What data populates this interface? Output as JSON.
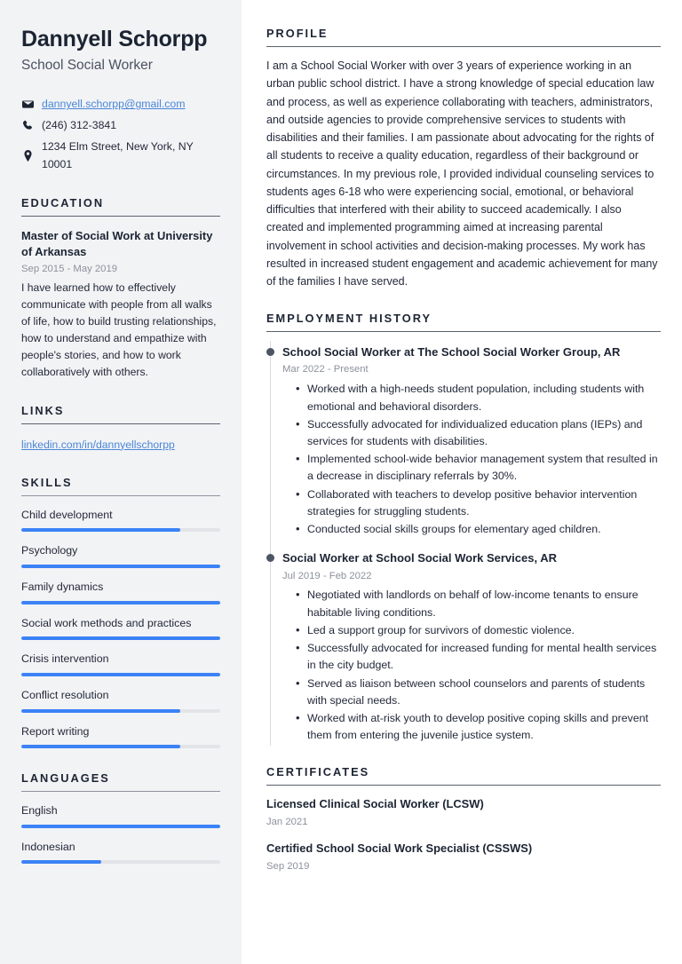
{
  "theme": {
    "sidebar_bg": "#f2f3f5",
    "main_bg": "#ffffff",
    "text_color": "#23293a",
    "heading_color": "#1c2433",
    "muted_color": "#8c919c",
    "link_color": "#4a86d8",
    "accent_bar": "#3b82f6",
    "bar_track": "#e2e4e7",
    "timeline_dot": "#4d5565"
  },
  "sidebar": {
    "name": "Dannyell Schorpp",
    "job_title": "School Social Worker",
    "contacts": [
      {
        "icon": "envelope-icon",
        "text": "dannyell.schorpp@gmail.com",
        "is_link": true
      },
      {
        "icon": "phone-icon",
        "text": "(246) 312-3841",
        "is_link": false
      },
      {
        "icon": "location-pin-icon",
        "text": "1234 Elm Street, New York, NY 10001",
        "is_link": false
      }
    ],
    "education": {
      "heading": "EDUCATION",
      "items": [
        {
          "title": "Master of Social Work at University of Arkansas",
          "date": "Sep 2015 - May 2019",
          "description": "I have learned how to effectively communicate with people from all walks of life, how to build trusting relationships, how to understand and empathize with people's stories, and how to work collaboratively with others."
        }
      ]
    },
    "links": {
      "heading": "LINKS",
      "items": [
        {
          "label": "linkedin.com/in/dannyellschorpp"
        }
      ]
    },
    "skills": {
      "heading": "SKILLS",
      "items": [
        {
          "label": "Child development",
          "level": 80
        },
        {
          "label": "Psychology",
          "level": 100
        },
        {
          "label": "Family dynamics",
          "level": 100
        },
        {
          "label": "Social work methods and practices",
          "level": 100
        },
        {
          "label": "Crisis intervention",
          "level": 100
        },
        {
          "label": "Conflict resolution",
          "level": 80
        },
        {
          "label": "Report writing",
          "level": 80
        }
      ]
    },
    "languages": {
      "heading": "LANGUAGES",
      "items": [
        {
          "label": "English",
          "level": 100
        },
        {
          "label": "Indonesian",
          "level": 40
        }
      ]
    }
  },
  "main": {
    "profile": {
      "heading": "PROFILE",
      "text": "I am a School Social Worker with over 3 years of experience working in an urban public school district. I have a strong knowledge of special education law and process, as well as experience collaborating with teachers, administrators, and outside agencies to provide comprehensive services to students with disabilities and their families. I am passionate about advocating for the rights of all students to receive a quality education, regardless of their background or circumstances. In my previous role, I provided individual counseling services to students ages 6-18 who were experiencing social, emotional, or behavioral difficulties that interfered with their ability to succeed academically. I also created and implemented programming aimed at increasing parental involvement in school activities and decision-making processes. My work has resulted in increased student engagement and academic achievement for many of the families I have served."
    },
    "employment": {
      "heading": "EMPLOYMENT HISTORY",
      "jobs": [
        {
          "title": "School Social Worker at The School Social Worker Group, AR",
          "date": "Mar 2022 - Present",
          "bullets": [
            "Worked with a high-needs student population, including students with emotional and behavioral disorders.",
            "Successfully advocated for individualized education plans (IEPs) and services for students with disabilities.",
            "Implemented school-wide behavior management system that resulted in a decrease in disciplinary referrals by 30%.",
            "Collaborated with teachers to develop positive behavior intervention strategies for struggling students.",
            "Conducted social skills groups for elementary aged children."
          ]
        },
        {
          "title": "Social Worker at School Social Work Services, AR",
          "date": "Jul 2019 - Feb 2022",
          "bullets": [
            "Negotiated with landlords on behalf of low-income tenants to ensure habitable living conditions.",
            "Led a support group for survivors of domestic violence.",
            "Successfully advocated for increased funding for mental health services in the city budget.",
            "Served as liaison between school counselors and parents of students with special needs.",
            "Worked with at-risk youth to develop positive coping skills and prevent them from entering the juvenile justice system."
          ]
        }
      ]
    },
    "certificates": {
      "heading": "CERTIFICATES",
      "items": [
        {
          "title": "Licensed Clinical Social Worker (LCSW)",
          "date": "Jan 2021"
        },
        {
          "title": "Certified School Social Work Specialist (CSSWS)",
          "date": "Sep 2019"
        }
      ]
    }
  }
}
